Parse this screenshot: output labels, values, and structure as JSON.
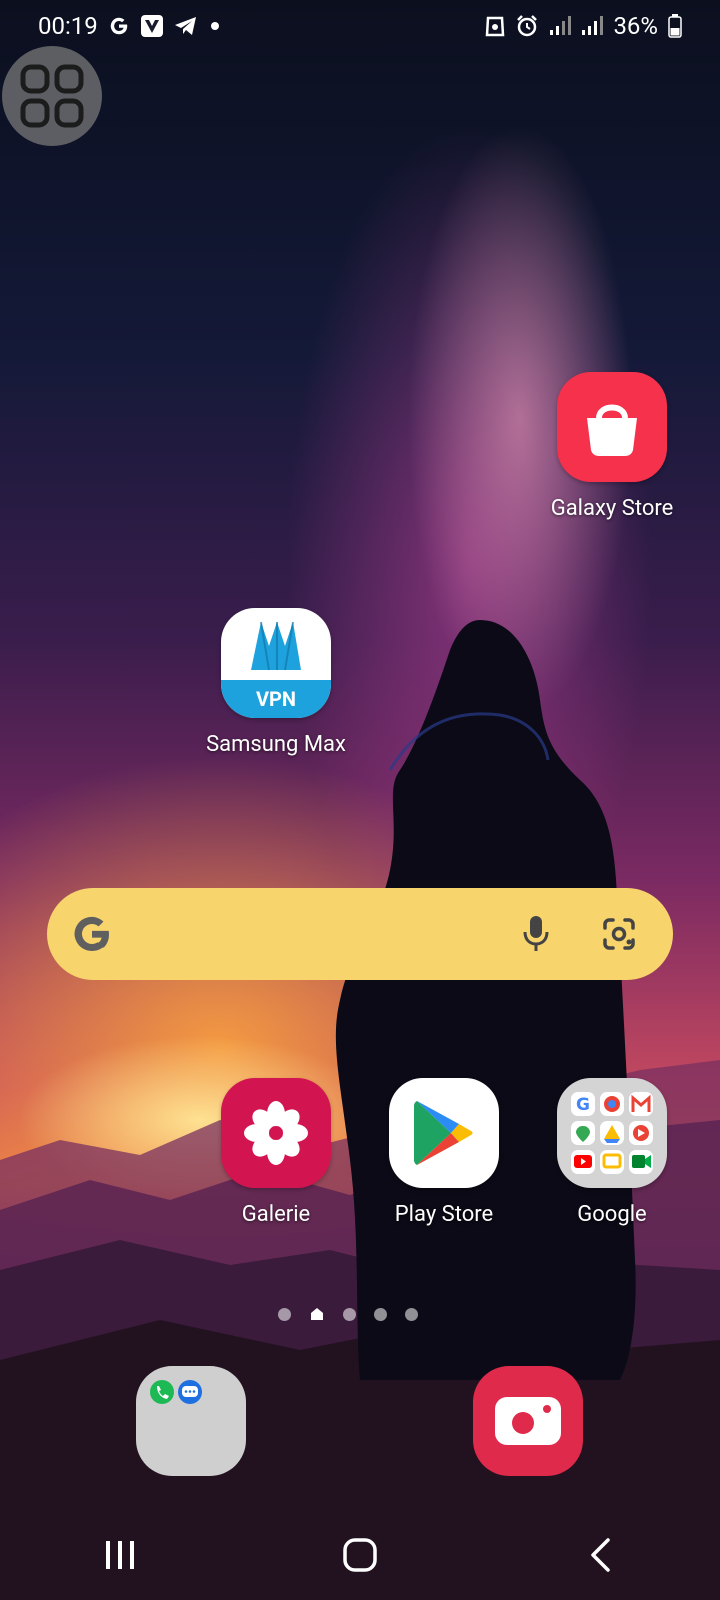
{
  "status_bar": {
    "time": "00:19",
    "battery_percent": "36%",
    "left_icons": [
      "google-g-icon",
      "vivaldi-icon",
      "telegram-icon",
      "dot-icon"
    ],
    "right_icons": [
      "recycle-icon",
      "alarm-icon",
      "signal-icon",
      "signal-icon",
      "battery-icon"
    ]
  },
  "home_screen": {
    "apps": {
      "galaxy_store": "Galaxy Store",
      "samsung_max": "Samsung Max",
      "galerie": "Galerie",
      "play_store": "Play Store",
      "google": "Google"
    },
    "vpn_badge": "VPN",
    "search_widget": {
      "icons": [
        "google-g-icon",
        "microphone-icon",
        "google-lens-icon"
      ]
    },
    "page_indicator": {
      "pages": 5,
      "current_page": 2
    },
    "dock": {
      "items": [
        "phone-messages-folder",
        "camera"
      ]
    }
  },
  "navigation_bar": {
    "buttons": [
      "recents",
      "home",
      "back"
    ]
  },
  "colors": {
    "search_bar": "#f7d46c",
    "galaxy_store": "#f5314b",
    "galerie": "#d21451",
    "camera": "#e02a4c",
    "vpn_blue": "#1ea2dd"
  }
}
